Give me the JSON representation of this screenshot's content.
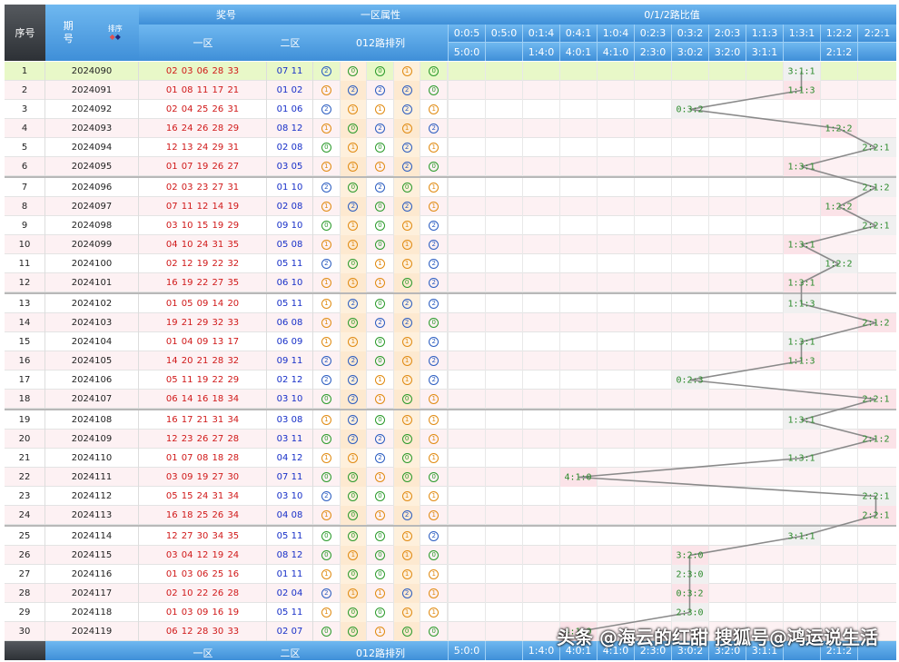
{
  "header": {
    "seq": "序号",
    "period": "期号",
    "sort": "排序",
    "prize": "奖号",
    "zone1": "一区",
    "zone2": "二区",
    "attr": "一区属性",
    "arr012": "012路排列",
    "ratio_title": "0/1/2路比值"
  },
  "ratio_cols_top": [
    "0:0:5",
    "0:5:0",
    "0:1:4",
    "0:4:1",
    "1:0:4",
    "0:2:3",
    "0:3:2",
    "2:0:3",
    "1:1:3",
    "1:3:1",
    "1:2:2",
    "2:2:1"
  ],
  "ratio_cols_bottom": [
    "5:0:0",
    "",
    "1:4:0",
    "4:0:1",
    "4:1:0",
    "2:3:0",
    "3:0:2",
    "3:2:0",
    "3:1:1",
    "",
    "2:1:2",
    ""
  ],
  "footer": {
    "zone1": "一区",
    "zone2": "二区",
    "arr012": "012路排列",
    "cols": [
      "5:0:0",
      "",
      "1:4:0",
      "4:0:1",
      "4:1:0",
      "2:3:0",
      "3:0:2",
      "3:2:0",
      "3:1:1",
      "",
      "2:1:2",
      ""
    ]
  },
  "watermark": "头条 @海云的红甜 搜狐号@鸿运说生活",
  "rows": [
    {
      "seq": "1",
      "period": "2024090",
      "z1": "02 03 06 28 33",
      "z2": "07 11",
      "attr": [
        2,
        0,
        0,
        1,
        0
      ],
      "ratio": "3:1:1",
      "col": 9
    },
    {
      "seq": "2",
      "period": "2024091",
      "z1": "01 08 11 17 21",
      "z2": "01 02",
      "attr": [
        1,
        2,
        2,
        2,
        0
      ],
      "ratio": "1:1:3",
      "col": 9
    },
    {
      "seq": "3",
      "period": "2024092",
      "z1": "02 04 25 26 31",
      "z2": "01 06",
      "attr": [
        2,
        1,
        1,
        2,
        1
      ],
      "ratio": "0:3:2",
      "col": 6
    },
    {
      "seq": "4",
      "period": "2024093",
      "z1": "16 24 26 28 29",
      "z2": "08 12",
      "attr": [
        1,
        0,
        2,
        1,
        2
      ],
      "ratio": "1:2:2",
      "col": 10
    },
    {
      "seq": "5",
      "period": "2024094",
      "z1": "12 13 24 29 31",
      "z2": "02 08",
      "attr": [
        0,
        1,
        0,
        2,
        1
      ],
      "ratio": "2:2:1",
      "col": 11
    },
    {
      "seq": "6",
      "period": "2024095",
      "z1": "01 07 19 26 27",
      "z2": "03 05",
      "attr": [
        1,
        1,
        1,
        2,
        0
      ],
      "ratio": "1:3:1",
      "col": 9
    },
    {
      "seq": "7",
      "period": "2024096",
      "z1": "02 03 23 27 31",
      "z2": "01 10",
      "attr": [
        2,
        0,
        2,
        0,
        1
      ],
      "ratio": "2:1:2",
      "col": 11
    },
    {
      "seq": "8",
      "period": "2024097",
      "z1": "07 11 12 14 19",
      "z2": "02 08",
      "attr": [
        1,
        2,
        0,
        2,
        1
      ],
      "ratio": "1:2:2",
      "col": 10
    },
    {
      "seq": "9",
      "period": "2024098",
      "z1": "03 10 15 19 29",
      "z2": "09 10",
      "attr": [
        0,
        1,
        0,
        1,
        2
      ],
      "ratio": "2:2:1",
      "col": 11
    },
    {
      "seq": "10",
      "period": "2024099",
      "z1": "04 10 24 31 35",
      "z2": "05 08",
      "attr": [
        1,
        1,
        0,
        1,
        2
      ],
      "ratio": "1:3:1",
      "col": 9
    },
    {
      "seq": "11",
      "period": "2024100",
      "z1": "02 12 19 22 32",
      "z2": "05 11",
      "attr": [
        2,
        0,
        1,
        1,
        2
      ],
      "ratio": "1:2:2",
      "col": 10
    },
    {
      "seq": "12",
      "period": "2024101",
      "z1": "16 19 22 27 35",
      "z2": "06 10",
      "attr": [
        1,
        1,
        1,
        0,
        2
      ],
      "ratio": "1:3:1",
      "col": 9
    },
    {
      "seq": "13",
      "period": "2024102",
      "z1": "01 05 09 14 20",
      "z2": "05 11",
      "attr": [
        1,
        2,
        0,
        2,
        2
      ],
      "ratio": "1:1:3",
      "col": 9
    },
    {
      "seq": "14",
      "period": "2024103",
      "z1": "19 21 29 32 33",
      "z2": "06 08",
      "attr": [
        1,
        0,
        2,
        2,
        0
      ],
      "ratio": "2:1:2",
      "col": 11
    },
    {
      "seq": "15",
      "period": "2024104",
      "z1": "01 04 09 13 17",
      "z2": "06 09",
      "attr": [
        1,
        1,
        0,
        1,
        2
      ],
      "ratio": "1:3:1",
      "col": 9
    },
    {
      "seq": "16",
      "period": "2024105",
      "z1": "14 20 21 28 32",
      "z2": "09 11",
      "attr": [
        2,
        2,
        0,
        1,
        2
      ],
      "ratio": "1:1:3",
      "col": 9
    },
    {
      "seq": "17",
      "period": "2024106",
      "z1": "05 11 19 22 29",
      "z2": "02 12",
      "attr": [
        2,
        2,
        1,
        1,
        2
      ],
      "ratio": "0:2:3",
      "col": 6
    },
    {
      "seq": "18",
      "period": "2024107",
      "z1": "06 14 16 18 34",
      "z2": "03 10",
      "attr": [
        0,
        2,
        1,
        0,
        1
      ],
      "ratio": "2:2:1",
      "col": 11
    },
    {
      "seq": "19",
      "period": "2024108",
      "z1": "16 17 21 31 34",
      "z2": "03 08",
      "attr": [
        1,
        2,
        0,
        1,
        1
      ],
      "ratio": "1:3:1",
      "col": 9
    },
    {
      "seq": "20",
      "period": "2024109",
      "z1": "12 23 26 27 28",
      "z2": "03 11",
      "attr": [
        0,
        2,
        2,
        0,
        1
      ],
      "ratio": "2:1:2",
      "col": 11
    },
    {
      "seq": "21",
      "period": "2024110",
      "z1": "01 07 08 18 28",
      "z2": "04 12",
      "attr": [
        1,
        1,
        2,
        0,
        1
      ],
      "ratio": "1:3:1",
      "col": 9
    },
    {
      "seq": "22",
      "period": "2024111",
      "z1": "03 09 19 27 30",
      "z2": "07 11",
      "attr": [
        0,
        0,
        1,
        0,
        0
      ],
      "ratio": "4:1:0",
      "col": 3
    },
    {
      "seq": "23",
      "period": "2024112",
      "z1": "05 15 24 31 34",
      "z2": "03 10",
      "attr": [
        2,
        0,
        0,
        1,
        1
      ],
      "ratio": "2:2:1",
      "col": 11
    },
    {
      "seq": "24",
      "period": "2024113",
      "z1": "16 18 25 26 34",
      "z2": "04 08",
      "attr": [
        1,
        0,
        1,
        2,
        1
      ],
      "ratio": "2:2:1",
      "col": 11
    },
    {
      "seq": "25",
      "period": "2024114",
      "z1": "12 27 30 34 35",
      "z2": "05 11",
      "attr": [
        0,
        0,
        0,
        1,
        2
      ],
      "ratio": "3:1:1",
      "col": 9
    },
    {
      "seq": "26",
      "period": "2024115",
      "z1": "03 04 12 19 24",
      "z2": "08 12",
      "attr": [
        0,
        1,
        0,
        1,
        0
      ],
      "ratio": "3:2:0",
      "col": 6
    },
    {
      "seq": "27",
      "period": "2024116",
      "z1": "01 03 06 25 16",
      "z2": "01 11",
      "attr": [
        1,
        0,
        0,
        1,
        1
      ],
      "ratio": "2:3:0",
      "col": 6
    },
    {
      "seq": "28",
      "period": "2024117",
      "z1": "02 10 22 26 28",
      "z2": "02 04",
      "attr": [
        2,
        1,
        1,
        2,
        1
      ],
      "ratio": "0:3:2",
      "col": 6
    },
    {
      "seq": "29",
      "period": "2024118",
      "z1": "01 03 09 16 19",
      "z2": "05 11",
      "attr": [
        1,
        0,
        0,
        1,
        1
      ],
      "ratio": "2:3:0",
      "col": 6
    },
    {
      "seq": "30",
      "period": "2024119",
      "z1": "06 12 28 30 33",
      "z2": "02 07",
      "attr": [
        0,
        0,
        1,
        0,
        0
      ],
      "ratio": "4:1:0",
      "col": 3
    }
  ]
}
